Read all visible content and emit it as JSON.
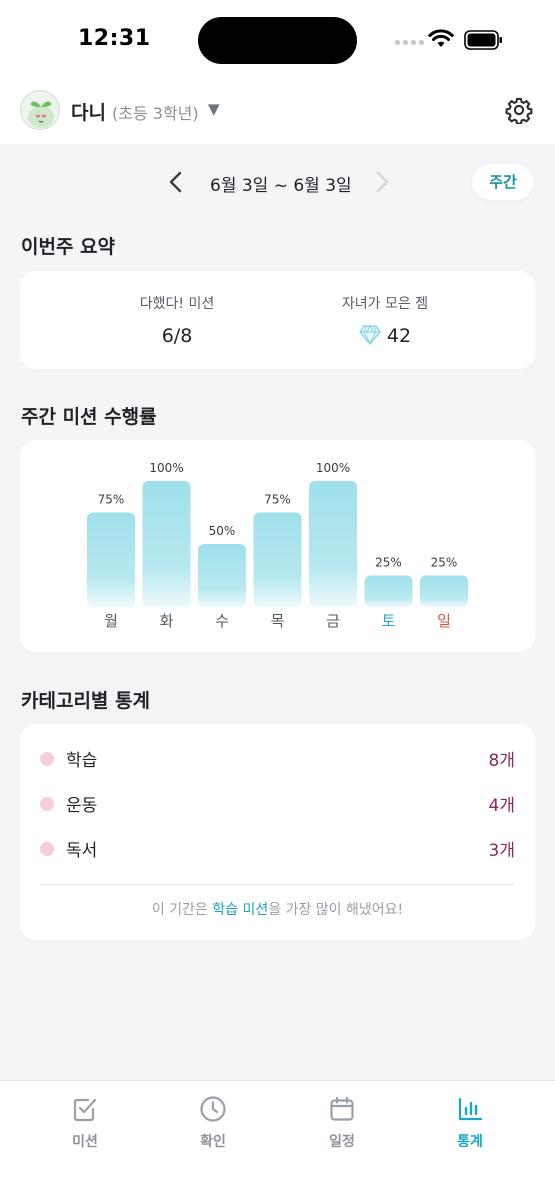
{
  "status_bar": {
    "time": "12:31"
  },
  "header": {
    "child_name": "다니",
    "child_grade": "(초등 3학년)",
    "dropdown_glyph": "▼",
    "icons": {
      "avatar": "sprout-avatar-icon",
      "settings": "gear-icon"
    }
  },
  "date_nav": {
    "range": "6월 3일 ~ 6월 3일",
    "period": "주간"
  },
  "summary": {
    "title": "이번주 요약",
    "missions_label": "다했다! 미션",
    "missions_value": "6/8",
    "gems_label": "자녀가 모은 젬",
    "gems_value": "42"
  },
  "weekly": {
    "title": "주간 미션 수행률"
  },
  "chart_data": {
    "type": "bar",
    "categories": [
      "월",
      "화",
      "수",
      "목",
      "금",
      "토",
      "일"
    ],
    "values": [
      75,
      100,
      50,
      75,
      100,
      25,
      25
    ],
    "value_labels": [
      "75%",
      "100%",
      "50%",
      "75%",
      "100%",
      "25%",
      "25%"
    ],
    "ylim": [
      0,
      100
    ],
    "grid": false,
    "colors": {
      "bar_top": "#9ee0ea",
      "bar_bottom": "#ecf9fb",
      "weekday_label": "#555b61",
      "saturday_label": "#1aa6c4",
      "sunday_label": "#e0533a"
    }
  },
  "categories": {
    "title": "카테고리별 통계",
    "items": [
      {
        "name": "학습",
        "count": "8개"
      },
      {
        "name": "운동",
        "count": "4개"
      },
      {
        "name": "독서",
        "count": "3개"
      }
    ],
    "note_prefix": "이 기간은 ",
    "note_highlight": "학습 미션",
    "note_suffix": "을 가장 많이 해냈어요!"
  },
  "tab_bar": {
    "tabs": [
      {
        "label": "미션",
        "icon": "checkbox-icon",
        "active": false
      },
      {
        "label": "확인",
        "icon": "clock-icon",
        "active": false
      },
      {
        "label": "일정",
        "icon": "calendar-icon",
        "active": false
      },
      {
        "label": "통계",
        "icon": "bar-chart-icon",
        "active": true
      }
    ]
  }
}
